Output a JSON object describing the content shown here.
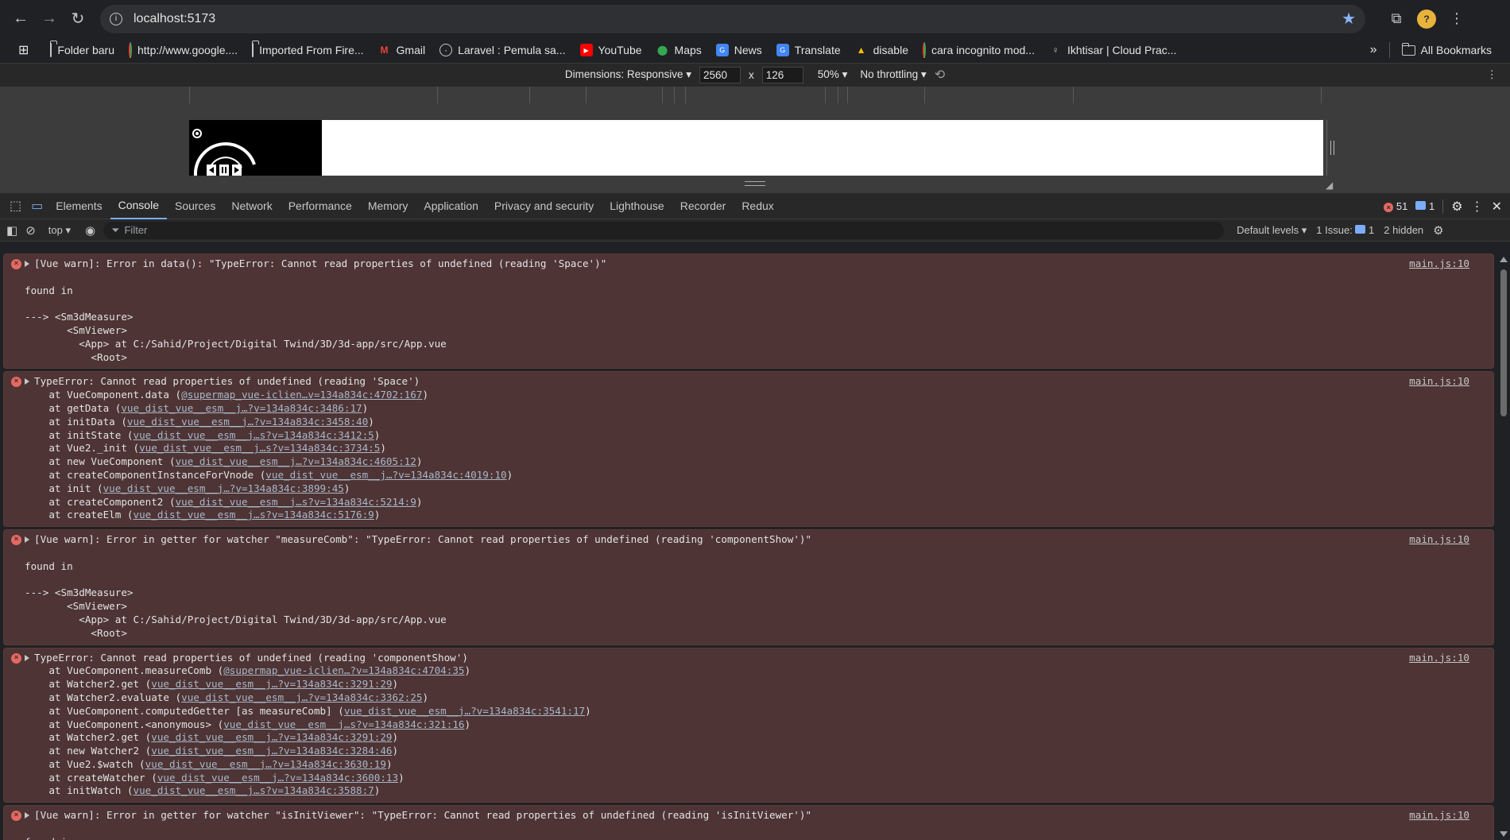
{
  "browser": {
    "url": "localhost:5173",
    "bookmarks": [
      {
        "label": "Folder baru",
        "icon": "folder-icon"
      },
      {
        "label": "http://www.google....",
        "icon": "google-icon"
      },
      {
        "label": "Imported From Fire...",
        "icon": "folder-icon"
      },
      {
        "label": "Gmail",
        "icon": "gmail-icon"
      },
      {
        "label": "Laravel : Pemula sa...",
        "icon": "globe-icon"
      },
      {
        "label": "YouTube",
        "icon": "youtube-icon"
      },
      {
        "label": "Maps",
        "icon": "maps-icon"
      },
      {
        "label": "News",
        "icon": "news-icon"
      },
      {
        "label": "Translate",
        "icon": "translate-icon"
      },
      {
        "label": "disable",
        "icon": "drive-icon"
      },
      {
        "label": "cara incognito mod...",
        "icon": "google-icon"
      },
      {
        "label": "Ikhtisar | Cloud Prac...",
        "icon": "cloud-icon"
      }
    ],
    "all_bookmarks": "All Bookmarks",
    "overflow": "»"
  },
  "device_toolbar": {
    "dimensions_label": "Dimensions: Responsive",
    "width": "2560",
    "times": "x",
    "height": "126",
    "zoom": "50%",
    "throttling": "No throttling"
  },
  "devtools": {
    "tabs": [
      "Elements",
      "Console",
      "Sources",
      "Network",
      "Performance",
      "Memory",
      "Application",
      "Privacy and security",
      "Lighthouse",
      "Recorder",
      "Redux"
    ],
    "active_tab": "Console",
    "error_count": "51",
    "message_count": "1"
  },
  "console_bar": {
    "context": "top",
    "filter_placeholder": "Filter",
    "levels": "Default levels",
    "issues_label": "1 Issue:",
    "issues_count": "1",
    "hidden": "2 hidden"
  },
  "messages": [
    {
      "source": "main.js:10",
      "header": "[Vue warn]: Error in data(): \"TypeError: Cannot read properties of undefined (reading 'Space')\"",
      "lines": [
        "",
        "found in",
        "",
        "---> <Sm3dMeasure>",
        "       <SmViewer>",
        "         <App> at C:/Sahid/Project/Digital Twind/3D/3d-app/src/App.vue",
        "           <Root>"
      ]
    },
    {
      "source": "main.js:10",
      "header": "TypeError: Cannot read properties of undefined (reading 'Space')",
      "stack": [
        {
          "fn": "    at VueComponent.data (",
          "link": "@supermap_vue-iclien…v=134a834c:4702:167",
          "end": ")"
        },
        {
          "fn": "    at getData (",
          "link": "vue_dist_vue__esm__j…?v=134a834c:3486:17",
          "end": ")"
        },
        {
          "fn": "    at initData (",
          "link": "vue_dist_vue__esm__j…?v=134a834c:3458:40",
          "end": ")"
        },
        {
          "fn": "    at initState (",
          "link": "vue_dist_vue__esm__j…s?v=134a834c:3412:5",
          "end": ")"
        },
        {
          "fn": "    at Vue2._init (",
          "link": "vue_dist_vue__esm__j…s?v=134a834c:3734:5",
          "end": ")"
        },
        {
          "fn": "    at new VueComponent (",
          "link": "vue_dist_vue__esm__j…?v=134a834c:4605:12",
          "end": ")"
        },
        {
          "fn": "    at createComponentInstanceForVnode (",
          "link": "vue_dist_vue__esm__j…?v=134a834c:4019:10",
          "end": ")"
        },
        {
          "fn": "    at init (",
          "link": "vue_dist_vue__esm__j…?v=134a834c:3899:45",
          "end": ")"
        },
        {
          "fn": "    at createComponent2 (",
          "link": "vue_dist_vue__esm__j…s?v=134a834c:5214:9",
          "end": ")"
        },
        {
          "fn": "    at createElm (",
          "link": "vue_dist_vue__esm__j…s?v=134a834c:5176:9",
          "end": ")"
        }
      ]
    },
    {
      "source": "main.js:10",
      "header": "[Vue warn]: Error in getter for watcher \"measureComb\": \"TypeError: Cannot read properties of undefined (reading 'componentShow')\"",
      "lines": [
        "",
        "found in",
        "",
        "---> <Sm3dMeasure>",
        "       <SmViewer>",
        "         <App> at C:/Sahid/Project/Digital Twind/3D/3d-app/src/App.vue",
        "           <Root>"
      ]
    },
    {
      "source": "main.js:10",
      "header": "TypeError: Cannot read properties of undefined (reading 'componentShow')",
      "stack": [
        {
          "fn": "    at VueComponent.measureComb (",
          "link": "@supermap_vue-iclien…?v=134a834c:4704:35",
          "end": ")"
        },
        {
          "fn": "    at Watcher2.get (",
          "link": "vue_dist_vue__esm__j…?v=134a834c:3291:29",
          "end": ")"
        },
        {
          "fn": "    at Watcher2.evaluate (",
          "link": "vue_dist_vue__esm__j…?v=134a834c:3362:25",
          "end": ")"
        },
        {
          "fn": "    at VueComponent.computedGetter [as measureComb] (",
          "link": "vue_dist_vue__esm__j…?v=134a834c:3541:17",
          "end": ")"
        },
        {
          "fn": "    at VueComponent.<anonymous> (",
          "link": "vue_dist_vue__esm__j…s?v=134a834c:321:16",
          "end": ")"
        },
        {
          "fn": "    at Watcher2.get (",
          "link": "vue_dist_vue__esm__j…?v=134a834c:3291:29",
          "end": ")"
        },
        {
          "fn": "    at new Watcher2 (",
          "link": "vue_dist_vue__esm__j…?v=134a834c:3284:46",
          "end": ")"
        },
        {
          "fn": "    at Vue2.$watch (",
          "link": "vue_dist_vue__esm__j…?v=134a834c:3630:19",
          "end": ")"
        },
        {
          "fn": "    at createWatcher (",
          "link": "vue_dist_vue__esm__j…?v=134a834c:3600:13",
          "end": ")"
        },
        {
          "fn": "    at initWatch (",
          "link": "vue_dist_vue__esm__j…s?v=134a834c:3588:7",
          "end": ")"
        }
      ]
    },
    {
      "source": "main.js:10",
      "header": "[Vue warn]: Error in getter for watcher \"isInitViewer\": \"TypeError: Cannot read properties of undefined (reading 'isInitViewer')\"",
      "lines": [
        "",
        "found in"
      ]
    }
  ]
}
